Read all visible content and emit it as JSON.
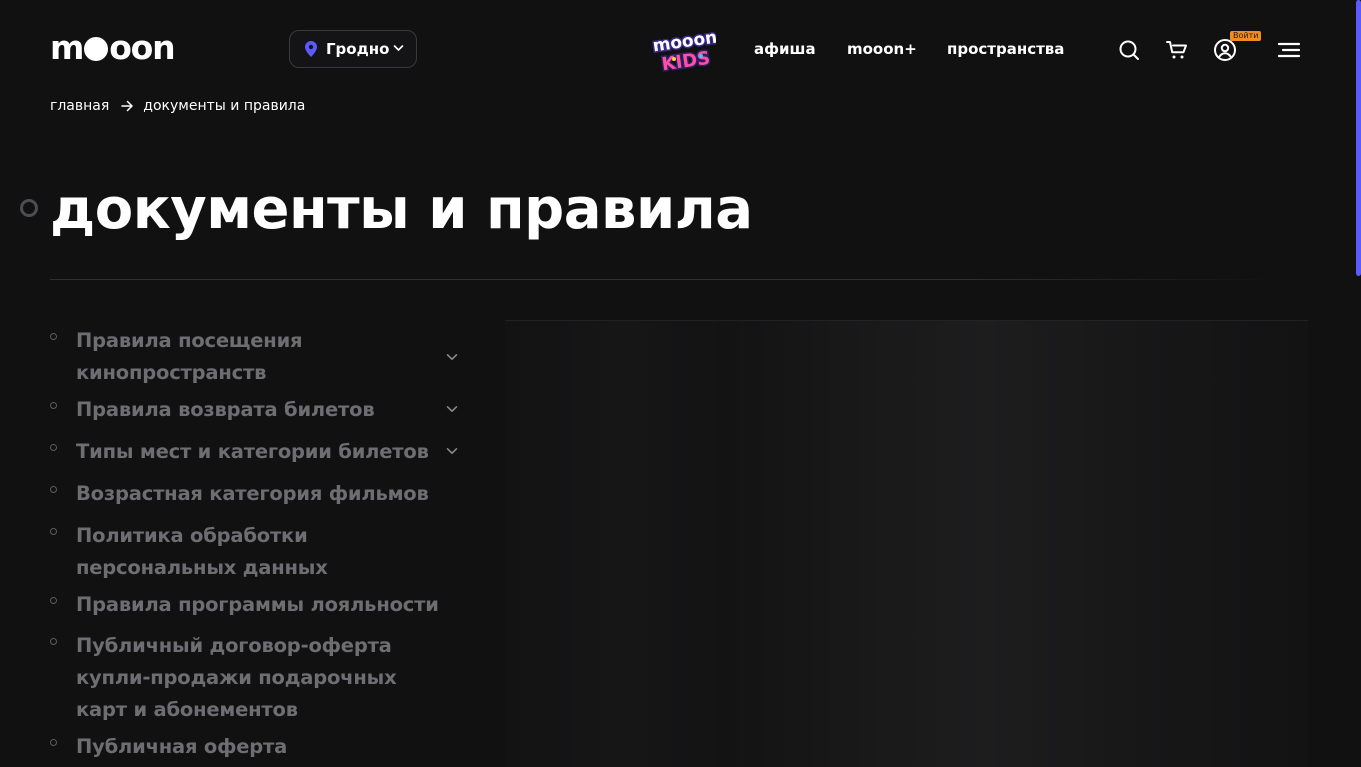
{
  "header": {
    "logo_text": "mooon",
    "city": "Гродно",
    "kids_logo": "mooon KIDS",
    "nav": [
      {
        "label": "афиша"
      },
      {
        "label": "mooon+"
      },
      {
        "label": "пространства"
      }
    ],
    "login_badge": "Войти",
    "icons": [
      "search-icon",
      "cart-icon",
      "user-icon",
      "menu-icon"
    ]
  },
  "breadcrumb": {
    "home": "главная",
    "current": "документы и правила"
  },
  "page": {
    "title": "документы и правила"
  },
  "documents": [
    {
      "label": "Правила посещения кинопространств",
      "expandable": true
    },
    {
      "label": "Правила возврата билетов",
      "expandable": true
    },
    {
      "label": "Типы мест и категории билетов",
      "expandable": true
    },
    {
      "label": "Возрастная категория фильмов",
      "expandable": false
    },
    {
      "label": "Политика обработки персональных данных",
      "expandable": false
    },
    {
      "label": "Правила программы лояльности",
      "expandable": false
    },
    {
      "label": "Публичный договор-оферта купли-продажи подарочных карт и абонементов",
      "expandable": false
    },
    {
      "label": "Публичная оферта",
      "expandable": false
    }
  ],
  "colors": {
    "background": "#111112",
    "accent": "#5a5aff",
    "badge": "#f28b21",
    "muted_text": "#6e6e72"
  }
}
